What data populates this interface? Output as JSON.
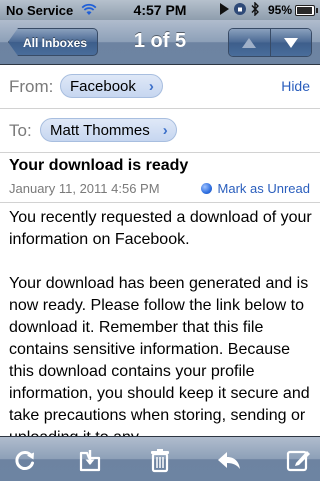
{
  "status_bar": {
    "carrier": "No Service",
    "time": "4:57 PM",
    "battery_percent": "95%",
    "battery_level": 0.95
  },
  "nav": {
    "back_label": "All Inboxes",
    "title": "1 of 5",
    "prev_icon": "up-arrow-icon",
    "next_icon": "down-arrow-icon"
  },
  "from": {
    "label": "From:",
    "sender": "Facebook",
    "hide_label": "Hide"
  },
  "to": {
    "label": "To:",
    "recipient": "Matt Thommes"
  },
  "message": {
    "subject": "Your download is ready",
    "date": "January 11, 2011 4:56 PM",
    "mark_unread_label": "Mark as Unread",
    "paragraphs": [
      "You recently requested a download of your information on Facebook.",
      "Your download has been generated and is now ready. Please follow the link below to download it. Remember that this file contains sensitive information. Because this download contains your profile information, you should keep it secure and take precautions when storing, sending or uploading it to any"
    ]
  },
  "toolbar": {
    "icons": [
      "refresh-icon",
      "move-icon",
      "trash-icon",
      "reply-icon",
      "compose-icon"
    ]
  },
  "colors": {
    "accent": "#2a5ebd",
    "chip_bg": "#c6d6f0",
    "bar": "#6d83a1"
  }
}
